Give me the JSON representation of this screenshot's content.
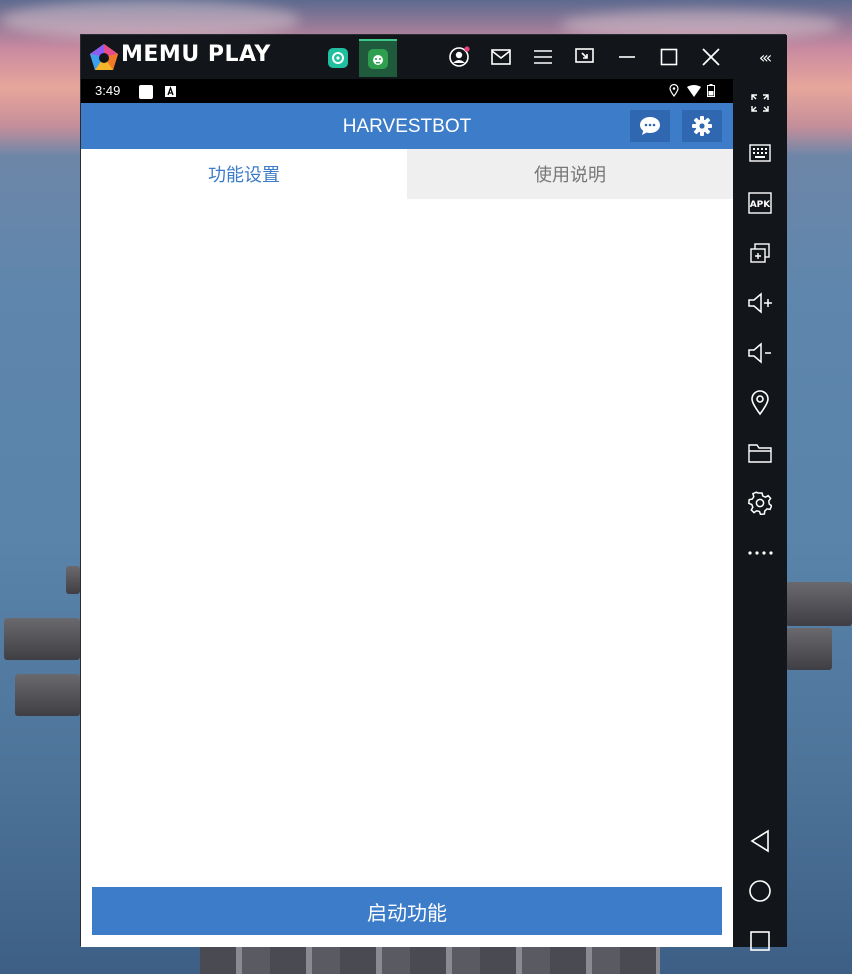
{
  "emulator": {
    "brand": "MEMU PLAY",
    "collapse_label": "‹‹‹",
    "toolbar_icons": [
      "account-icon",
      "mail-icon",
      "menu-icon",
      "screen-record-icon",
      "minimize-icon",
      "maximize-icon",
      "close-icon"
    ],
    "sidebar_icons": [
      "fullscreen-icon",
      "keyboard-icon",
      "apk-icon",
      "multi-window-icon",
      "volume-up-icon",
      "volume-down-icon",
      "location-icon",
      "folder-icon",
      "settings-icon",
      "more-icon",
      "back-icon",
      "home-icon",
      "recent-apps-icon"
    ],
    "apk_label": "APK"
  },
  "statusbar": {
    "time": "3:49"
  },
  "app": {
    "title": "HARVESTBOT",
    "tabs": [
      {
        "label": "功能设置",
        "active": true
      },
      {
        "label": "使用说明",
        "active": false
      }
    ],
    "start_button": "启动功能",
    "accent": "#3d7cc9"
  }
}
